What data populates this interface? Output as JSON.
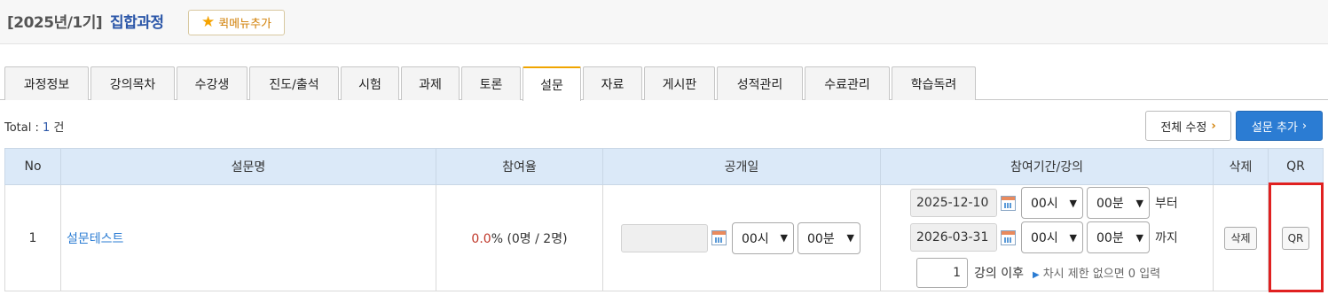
{
  "header": {
    "course_prefix": "[2025년/1기]",
    "course_name": "집합과정",
    "quick_menu_label": "퀵메뉴추가"
  },
  "tabs": [
    {
      "label": "과정정보"
    },
    {
      "label": "강의목차"
    },
    {
      "label": "수강생"
    },
    {
      "label": "진도/출석"
    },
    {
      "label": "시험"
    },
    {
      "label": "과제"
    },
    {
      "label": "토론"
    },
    {
      "label": "설문",
      "active": true
    },
    {
      "label": "자료"
    },
    {
      "label": "게시판"
    },
    {
      "label": "성적관리"
    },
    {
      "label": "수료관리"
    },
    {
      "label": "학습독려"
    }
  ],
  "summary": {
    "total_prefix": "Total : ",
    "total_count": "1",
    "total_suffix": " 건"
  },
  "actions": {
    "edit_all": "전체 수정",
    "add_survey": "설문 추가"
  },
  "table": {
    "headers": [
      "No",
      "설문명",
      "참여율",
      "공개일",
      "참여기간/강의",
      "삭제",
      "QR"
    ],
    "row": {
      "no": "1",
      "name": "설문테스트",
      "rate_pct": "0.0",
      "rate_rest": "% (0명 / 2명)",
      "publish": {
        "date": "",
        "hour": "00시",
        "minute": "00분"
      },
      "start": {
        "date": "2025-12-10",
        "hour": "00시",
        "minute": "00분",
        "word": "부터"
      },
      "end": {
        "date": "2026-03-31",
        "hour": "00시",
        "minute": "00분",
        "word": "까지"
      },
      "lecture": {
        "value": "1",
        "after": "강의 이후",
        "hint": "차시 제한 없으면 0 입력"
      },
      "delete_label": "삭제",
      "qr_label": "QR"
    }
  },
  "colors": {
    "accent_blue": "#2b7cd3",
    "course_name": "#2b56a8",
    "active_tab_top": "#f0a500",
    "highlight": "#e02020",
    "rate_pct": "#c0392b"
  }
}
